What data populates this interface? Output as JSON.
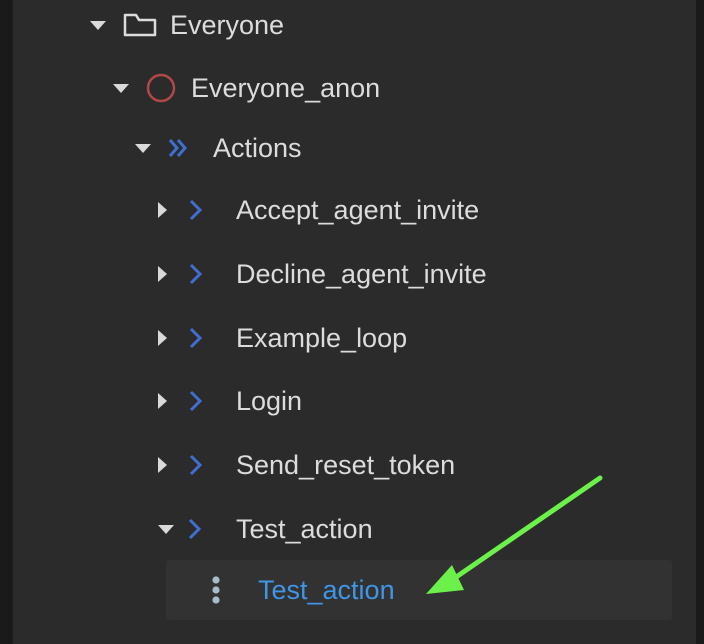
{
  "tree": {
    "folder": {
      "label": "Everyone",
      "icon": "folder-icon"
    },
    "role": {
      "label": "Everyone_anon",
      "icon": "circle-icon",
      "icon_color": "#b04848"
    },
    "group": {
      "label": "Actions",
      "icon": "double-chevron-icon",
      "icon_color": "#3f6fd0"
    },
    "actions": [
      {
        "label": "Accept_agent_invite",
        "expanded": false
      },
      {
        "label": "Decline_agent_invite",
        "expanded": false
      },
      {
        "label": "Example_loop",
        "expanded": false
      },
      {
        "label": "Login",
        "expanded": false
      },
      {
        "label": "Send_reset_token",
        "expanded": false
      },
      {
        "label": "Test_action",
        "expanded": true
      }
    ],
    "selected_child": {
      "label": "Test_action",
      "icon": "vertical-dots-icon",
      "color": "#3f95e6"
    }
  },
  "annotation": {
    "icon": "arrow-icon",
    "color": "#6cf04a"
  },
  "colors": {
    "background": "#2b2b2b",
    "text": "#dcdcdc",
    "chevron": "#3f6fd0"
  }
}
